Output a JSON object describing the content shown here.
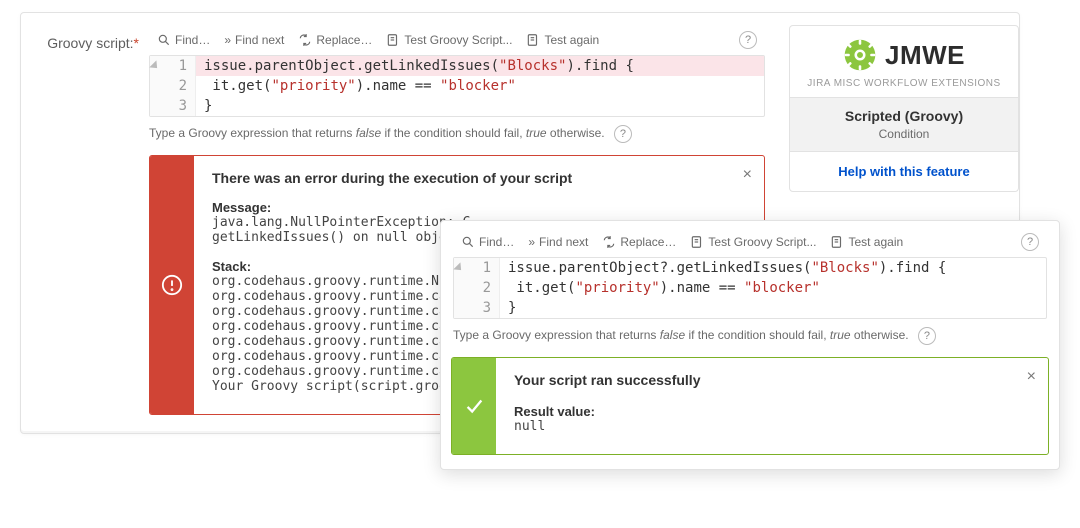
{
  "field_label": "Groovy script:",
  "toolbar": {
    "find": "Find…",
    "find_next": "Find next",
    "replace": "Replace…",
    "test1": "Test Groovy Script...",
    "test2": "Test again"
  },
  "code_error": {
    "lines": [
      {
        "num": "1",
        "hl": true,
        "parts": [
          {
            "t": "issue.parentObject.getLinkedIssues(",
            "c": "tok-k"
          },
          {
            "t": "\"Blocks\"",
            "c": "tok-s"
          },
          {
            "t": ").find {",
            "c": "tok-k"
          }
        ]
      },
      {
        "num": "2",
        "hl": false,
        "parts": [
          {
            "t": " it.get(",
            "c": "tok-k"
          },
          {
            "t": "\"priority\"",
            "c": "tok-s"
          },
          {
            "t": ").name == ",
            "c": "tok-k"
          },
          {
            "t": "\"blocker\"",
            "c": "tok-s"
          }
        ]
      },
      {
        "num": "3",
        "hl": false,
        "parts": [
          {
            "t": "}",
            "c": "tok-k"
          }
        ]
      }
    ]
  },
  "code_ok": {
    "lines": [
      {
        "num": "1",
        "hl": false,
        "parts": [
          {
            "t": "issue.parentObject?.getLinkedIssues(",
            "c": "tok-k"
          },
          {
            "t": "\"Blocks\"",
            "c": "tok-s"
          },
          {
            "t": ").find {",
            "c": "tok-k"
          }
        ]
      },
      {
        "num": "2",
        "hl": false,
        "parts": [
          {
            "t": " it.get(",
            "c": "tok-k"
          },
          {
            "t": "\"priority\"",
            "c": "tok-s"
          },
          {
            "t": ").name == ",
            "c": "tok-k"
          },
          {
            "t": "\"blocker\"",
            "c": "tok-s"
          }
        ]
      },
      {
        "num": "3",
        "hl": false,
        "parts": [
          {
            "t": "}",
            "c": "tok-k"
          }
        ]
      }
    ]
  },
  "hint": {
    "prefix": "Type a Groovy expression that returns ",
    "i1": "false",
    "mid": " if the condition should fail, ",
    "i2": "true",
    "suffix": " otherwise."
  },
  "error": {
    "heading": "There was an error during the execution of your script",
    "msg_label": "Message:",
    "msg_text": "java.lang.NullPointerException: C\ngetLinkedIssues() on null object",
    "stack_label": "Stack:",
    "stack_text": "org.codehaus.groovy.runtime.NullO\norg.codehaus.groovy.runtime.calls\norg.codehaus.groovy.runtime.calls\norg.codehaus.groovy.runtime.calls\norg.codehaus.groovy.runtime.calls\norg.codehaus.groovy.runtime.calls\norg.codehaus.groovy.runtime.calls\nYour Groovy script(script.groovy:"
  },
  "success": {
    "heading": "Your script ran successfully",
    "result_label": "Result value:",
    "result_value": "null"
  },
  "side": {
    "brand_name": "JMWE",
    "brand_sub": "JIRA MISC WORKFLOW EXTENSIONS",
    "title": "Scripted (Groovy)",
    "type": "Condition",
    "help": "Help with this feature"
  }
}
